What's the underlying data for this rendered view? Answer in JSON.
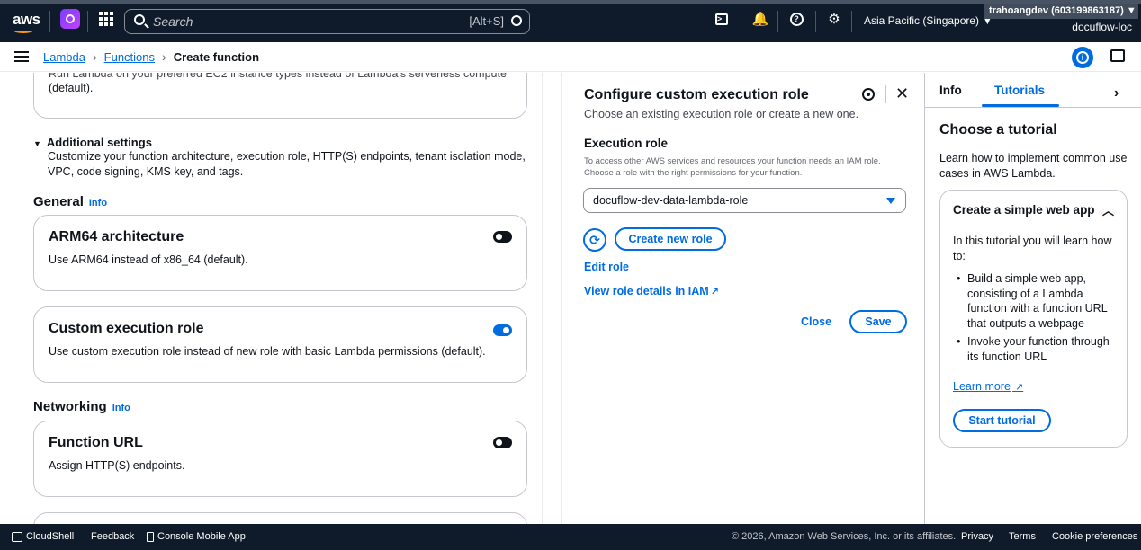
{
  "topbar": {
    "logo": "aws",
    "search_placeholder": "Search",
    "search_hint": "[Alt+S]",
    "region": "Asia Pacific (Singapore) ▼",
    "account": "trahoangdev (603199863187) ▼",
    "account_sub": "docuflow-loc"
  },
  "breadcrumb": {
    "items": [
      "Lambda",
      "Functions"
    ],
    "current": "Create function"
  },
  "left": {
    "clipped_top": "Run Lambda on your preferred EC2 instance types instead of Lambda's serverless compute",
    "clipped_default": "(default).",
    "additional_settings": {
      "title": "Additional settings",
      "description": "Customize your function architecture, execution role, HTTP(S) endpoints, tenant isolation mode, VPC, code signing, KMS key, and tags."
    },
    "general": {
      "title": "General",
      "info": "Info"
    },
    "arm64": {
      "title": "ARM64 architecture",
      "desc": "Use ARM64 instead of x86_64 (default).",
      "enabled": false
    },
    "custom_role": {
      "title": "Custom execution role",
      "desc": "Use custom execution role instead of new role with basic Lambda permissions (default).",
      "enabled": true
    },
    "networking": {
      "title": "Networking",
      "info": "Info"
    },
    "function_url": {
      "title": "Function URL",
      "desc": "Assign HTTP(S) endpoints.",
      "enabled": false
    }
  },
  "config_panel": {
    "title": "Configure custom execution role",
    "subtitle": "Choose an existing execution role or create a new one.",
    "execution_role_label": "Execution role",
    "execution_role_desc": "To access other AWS services and resources your function needs an IAM role. Choose a role with the right permissions for your function.",
    "selected_role": "docuflow-dev-data-lambda-role",
    "create_role": "Create new role",
    "edit_role": "Edit role",
    "view_iam": "View role details in IAM",
    "close": "Close",
    "save": "Save"
  },
  "tutorials": {
    "tab_info": "Info",
    "tab_tutorials": "Tutorials",
    "title": "Choose a tutorial",
    "description": "Learn how to implement common use cases in AWS Lambda.",
    "card": {
      "title": "Create a simple web app",
      "intro": "In this tutorial you will learn how to:",
      "items": [
        "Build a simple web app, consisting of a Lambda function with a function URL that outputs a webpage",
        "Invoke your function through its function URL"
      ],
      "learn_more": "Learn more",
      "start": "Start tutorial"
    }
  },
  "footer": {
    "cloudshell": "CloudShell",
    "feedback": "Feedback",
    "mobile_app": "Console Mobile App",
    "copyright": "© 2026, Amazon Web Services, Inc. or its affiliates.",
    "privacy": "Privacy",
    "terms": "Terms",
    "cookies": "Cookie preferences"
  },
  "colors": {
    "nav_bg": "#0f1b2a",
    "accent": "#006ce0",
    "border": "#c6c6cd"
  }
}
